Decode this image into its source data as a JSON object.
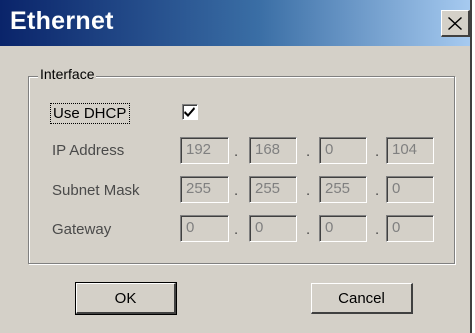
{
  "window": {
    "title": "Ethernet"
  },
  "interface": {
    "group_label": "Interface",
    "use_dhcp": {
      "label": "Use DHCP",
      "checked": true
    },
    "ip_address": {
      "label": "IP Address",
      "octets": [
        "192",
        "168",
        "0",
        "104"
      ]
    },
    "subnet_mask": {
      "label": "Subnet Mask",
      "octets": [
        "255",
        "255",
        "255",
        "0"
      ]
    },
    "gateway": {
      "label": "Gateway",
      "octets": [
        "0",
        "0",
        "0",
        "0"
      ]
    },
    "separator": "."
  },
  "buttons": {
    "ok": "OK",
    "cancel": "Cancel"
  },
  "icons": {
    "close": "close-icon",
    "check": "checkmark-icon"
  },
  "colors": {
    "titlebar_start": "#0a246a",
    "titlebar_end": "#a6caf0",
    "face": "#d4d0c8",
    "disabled_text": "#808080"
  }
}
